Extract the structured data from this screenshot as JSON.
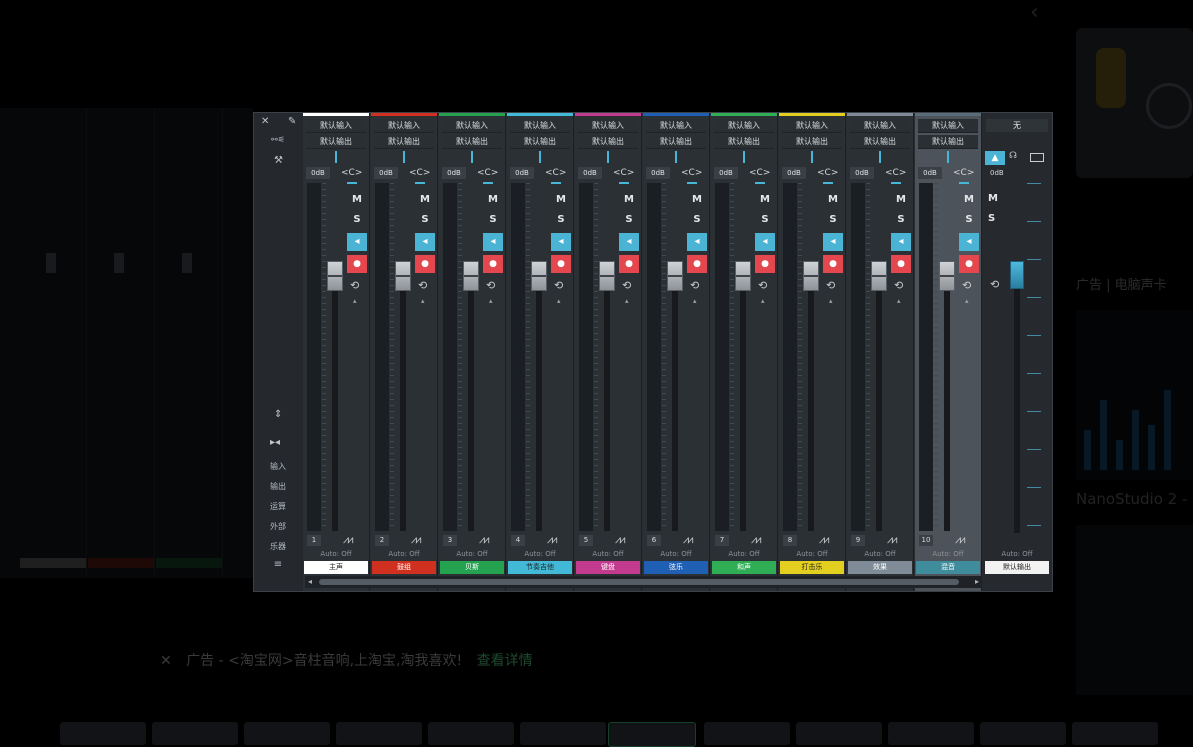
{
  "window": {
    "left_panel": {
      "top_label": "⚯⚟",
      "input_label": "输入",
      "output_label": "输出",
      "insert_label": "运算",
      "ext_label": "外部",
      "hint_label": "乐器",
      "menu_icon": "≡"
    },
    "strips": [
      {
        "num": "1",
        "name": "主声",
        "color": "#ffffff",
        "name_bg": "#ffffff",
        "name_fg": "#222222",
        "input": "默认输入",
        "output": "默认输出",
        "db": "0dB",
        "pan": "<C>",
        "auto": "Auto: Off",
        "selected": false
      },
      {
        "num": "2",
        "name": "鼓组",
        "color": "#d0301f",
        "name_bg": "#d0301f",
        "name_fg": "#ffffff",
        "input": "默认输入",
        "output": "默认输出",
        "db": "0dB",
        "pan": "<C>",
        "auto": "Auto: Off",
        "selected": false
      },
      {
        "num": "3",
        "name": "贝斯",
        "color": "#24a24f",
        "name_bg": "#24a24f",
        "name_fg": "#ffffff",
        "input": "默认输入",
        "output": "默认输出",
        "db": "0dB",
        "pan": "<C>",
        "auto": "Auto: Off",
        "selected": false
      },
      {
        "num": "4",
        "name": "节奏吉他",
        "color": "#42b9d6",
        "name_bg": "#42b9d6",
        "name_fg": "#222222",
        "input": "默认输入",
        "output": "默认输出",
        "db": "0dB",
        "pan": "<C>",
        "auto": "Auto: Off",
        "selected": false
      },
      {
        "num": "5",
        "name": "键盘",
        "color": "#c23b8f",
        "name_bg": "#c23b8f",
        "name_fg": "#ffffff",
        "input": "默认输入",
        "output": "默认输出",
        "db": "0dB",
        "pan": "<C>",
        "auto": "Auto: Off",
        "selected": false
      },
      {
        "num": "6",
        "name": "弦乐",
        "color": "#1f5fb4",
        "name_bg": "#1f5fb4",
        "name_fg": "#ffffff",
        "input": "默认输入",
        "output": "默认输出",
        "db": "0dB",
        "pan": "<C>",
        "auto": "Auto: Off",
        "selected": false
      },
      {
        "num": "7",
        "name": "和声",
        "color": "#2fae56",
        "name_bg": "#2fae56",
        "name_fg": "#ffffff",
        "input": "默认输入",
        "output": "默认输出",
        "db": "0dB",
        "pan": "<C>",
        "auto": "Auto: Off",
        "selected": false
      },
      {
        "num": "8",
        "name": "打击乐",
        "color": "#e2cf1f",
        "name_bg": "#e2cf1f",
        "name_fg": "#222222",
        "input": "默认输入",
        "output": "默认输出",
        "db": "0dB",
        "pan": "<C>",
        "auto": "Auto: Off",
        "selected": false
      },
      {
        "num": "9",
        "name": "效果",
        "color": "#7f8c97",
        "name_bg": "#7f8c97",
        "name_fg": "#ffffff",
        "input": "默认输入",
        "output": "默认输出",
        "db": "0dB",
        "pan": "<C>",
        "auto": "Auto: Off",
        "selected": false
      },
      {
        "num": "10",
        "name": "混音",
        "color": "#5a6b7a",
        "name_bg": "#3f8c9c",
        "name_fg": "#ffffff",
        "input": "默认输入",
        "output": "默认输出",
        "db": "0dB",
        "pan": "<C>",
        "auto": "Auto: Off",
        "selected": true
      }
    ],
    "master": {
      "input": "无",
      "db": "0dB",
      "auto": "Auto: Off",
      "name": "默认输出"
    }
  },
  "background": {
    "side_ad_label": "广告 | 电脑声卡",
    "side_product": "NanoStudio 2 -",
    "bottom_ad_close": "✕",
    "bottom_ad_text": "广告 - <淘宝网>音柱音响,上淘宝,淘我喜欢!",
    "bottom_ad_link": "查看详情"
  }
}
